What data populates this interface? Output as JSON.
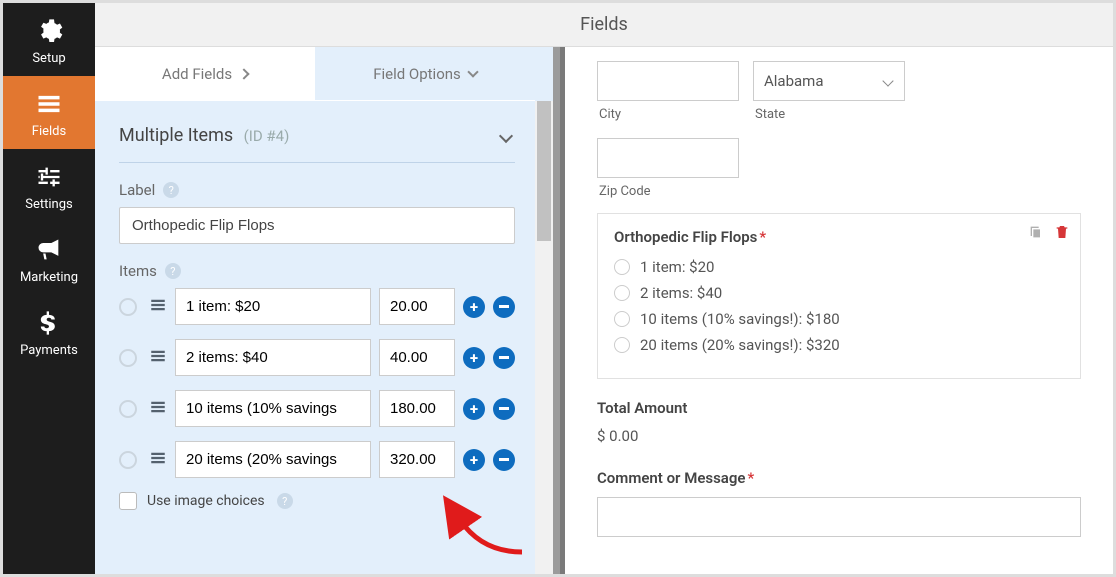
{
  "sidebar": {
    "items": [
      {
        "label": "Setup"
      },
      {
        "label": "Fields"
      },
      {
        "label": "Settings"
      },
      {
        "label": "Marketing"
      },
      {
        "label": "Payments"
      }
    ]
  },
  "header": {
    "title": "Fields"
  },
  "tabs": {
    "add": "Add Fields",
    "options": "Field Options"
  },
  "section": {
    "title": "Multiple Items",
    "id_text": "(ID #4)"
  },
  "label_field": {
    "label": "Label",
    "value": "Orthopedic Flip Flops"
  },
  "items_label": "Items",
  "items": [
    {
      "label": "1 item: $20",
      "price": "20.00"
    },
    {
      "label": "2 items: $40",
      "price": "40.00"
    },
    {
      "label": "10 items (10% savings",
      "price": "180.00"
    },
    {
      "label": "20 items (20% savings",
      "price": "320.00"
    }
  ],
  "image_choices_label": "Use image choices",
  "preview": {
    "city_label": "City",
    "state_label": "State",
    "state_value": "Alabama",
    "zip_label": "Zip Code",
    "field_title": "Orthopedic Flip Flops",
    "options": [
      "1 item: $20",
      "2 items: $40",
      "10 items (10% savings!): $180",
      "20 items (20% savings!): $320"
    ],
    "total_label": "Total Amount",
    "total_value": "$ 0.00",
    "comment_label": "Comment or Message"
  }
}
